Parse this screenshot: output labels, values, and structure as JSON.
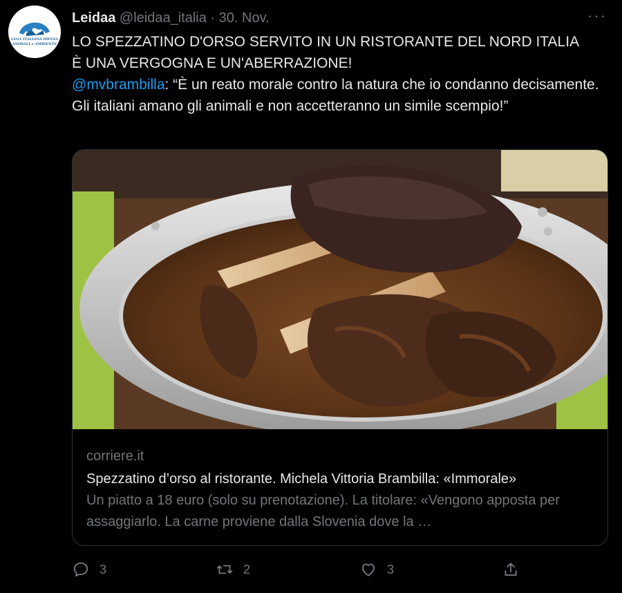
{
  "tweet": {
    "author_name": "Leidaa",
    "handle": "@leidaa_italia",
    "separator": "·",
    "date": "30. Nov.",
    "more_label": "···",
    "avatar_text_line1": "LEGA ITALIANA DIFESA",
    "avatar_text_line2": "ANIMALI e AMBIENTE",
    "headline_line1": "LO SPEZZATINO D'ORSO SERVITO IN UN RISTORANTE DEL NORD ITALIA",
    "headline_line2": "È UNA VERGOGNA E UN'ABERRAZIONE!",
    "mention": "@mvbrambilla",
    "quote": ": “È un reato morale contro la natura che io condanno decisamente. Gli italiani amano gli animali e non accetteranno un simile scempio!”"
  },
  "card": {
    "domain": "corriere.it",
    "title": "Spezzatino d’orso al ristorante. Michela Vittoria Brambilla: «Immorale»",
    "description": "Un piatto a 18 euro (solo su prenotazione). La titolare: «Vengono apposta per assaggiarlo. La carne proviene dalla Slovenia dove la …"
  },
  "actions": {
    "reply_count": "3",
    "retweet_count": "2",
    "like_count": "3"
  },
  "colors": {
    "background": "#000000",
    "text": "#e7e9ea",
    "muted": "#71767b",
    "link": "#1d9bf0",
    "border": "#2f3336"
  },
  "icons": [
    "reply-icon",
    "retweet-icon",
    "like-icon",
    "share-icon",
    "more-icon"
  ]
}
